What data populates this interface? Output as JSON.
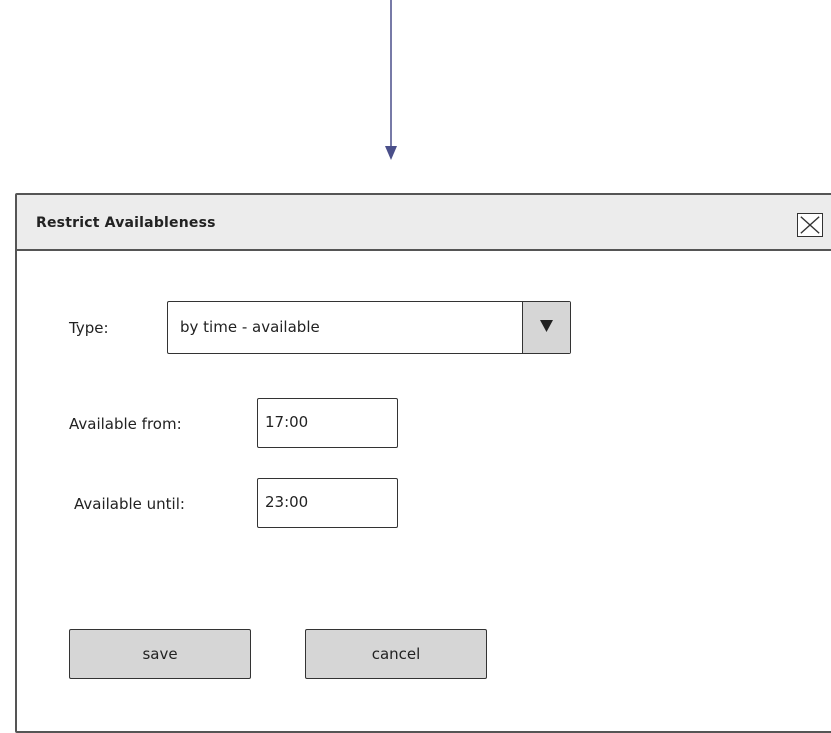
{
  "dialog": {
    "title": "Restrict Availableness",
    "close_icon": "close-x-icon"
  },
  "form": {
    "type_label": "Type:",
    "type_value": "by time - available",
    "dropdown_icon": "triangle-down-icon",
    "from_label": "Available from:",
    "from_value": "17:00",
    "until_label": "Available until:",
    "until_value": "23:00"
  },
  "actions": {
    "save_label": "save",
    "cancel_label": "cancel"
  },
  "colors": {
    "arrow": "#4a4f8a",
    "titlebar_bg": "#ececec",
    "button_bg": "#d6d6d6",
    "border": "#333333"
  }
}
